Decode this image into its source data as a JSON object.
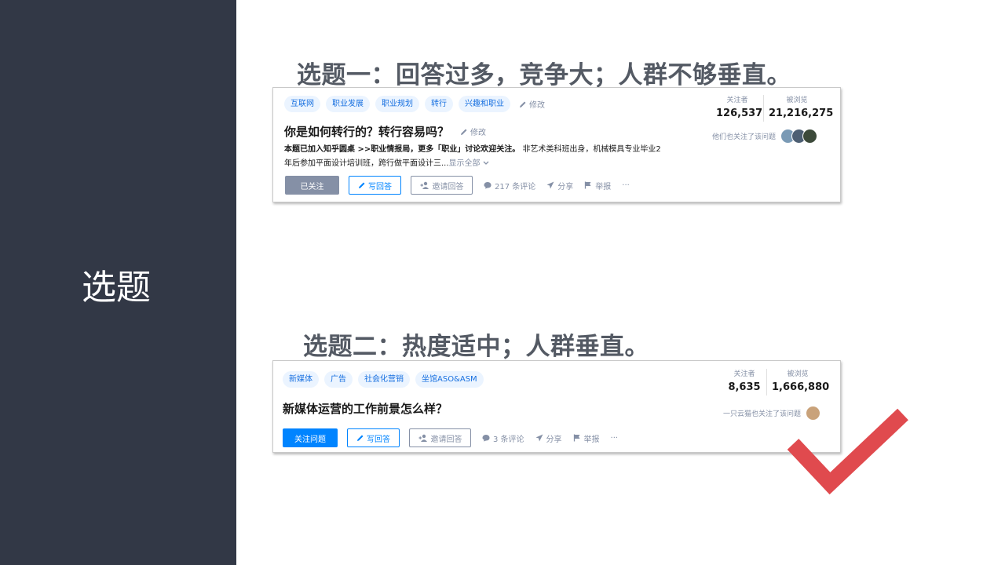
{
  "sidebar": {
    "title": "选题"
  },
  "heading1": "选题一：回答过多，竞争大；人群不够垂直。",
  "heading2": "选题二：热度适中；人群垂直。",
  "card1": {
    "tags": [
      "互联网",
      "职业发展",
      "职业规划",
      "转行",
      "兴趣和职业"
    ],
    "tag_edit": "修改",
    "title": "你是如何转行的？转行容易吗？",
    "title_edit": "修改",
    "desc_bold": "本题已加入知乎圆桌 >>职业情报局，更多「职业」讨论欢迎关注。",
    "desc_rest": "非艺术类科班出身，机械模具专业毕业2年后参加平面设计培训班，跨行做平面设计三...",
    "show_all": "显示全部",
    "stats": [
      {
        "label": "关注者",
        "value": "126,537"
      },
      {
        "label": "被浏览",
        "value": "21,216,275"
      }
    ],
    "follow_note": "他们也关注了该问题",
    "buttons": {
      "follow": "已关注",
      "answer": "写回答",
      "invite": "邀请回答"
    },
    "comments": "217 条评论",
    "share": "分享",
    "report": "举报",
    "more": "···"
  },
  "card2": {
    "tags": [
      "新媒体",
      "广告",
      "社会化营销",
      "坐馆ASO&ASM"
    ],
    "title": "新媒体运营的工作前景怎么样？",
    "stats": [
      {
        "label": "关注者",
        "value": "8,635"
      },
      {
        "label": "被浏览",
        "value": "1,666,880"
      }
    ],
    "follow_note": "一只云猫也关注了该问题",
    "buttons": {
      "follow": "关注问题",
      "answer": "写回答",
      "invite": "邀请回答"
    },
    "comments": "3 条评论",
    "share": "分享",
    "report": "举报",
    "more": "···"
  },
  "colors": {
    "sidebar_bg": "#323846",
    "accent_blue": "#0084ff",
    "checkmark": "#e04a4e",
    "heading": "#545a64"
  },
  "icons": {
    "edit": "pencil-icon",
    "comment": "comment-icon",
    "share": "paper-plane-icon",
    "report": "flag-icon",
    "invite": "add-user-icon",
    "check": "checkmark-icon"
  }
}
